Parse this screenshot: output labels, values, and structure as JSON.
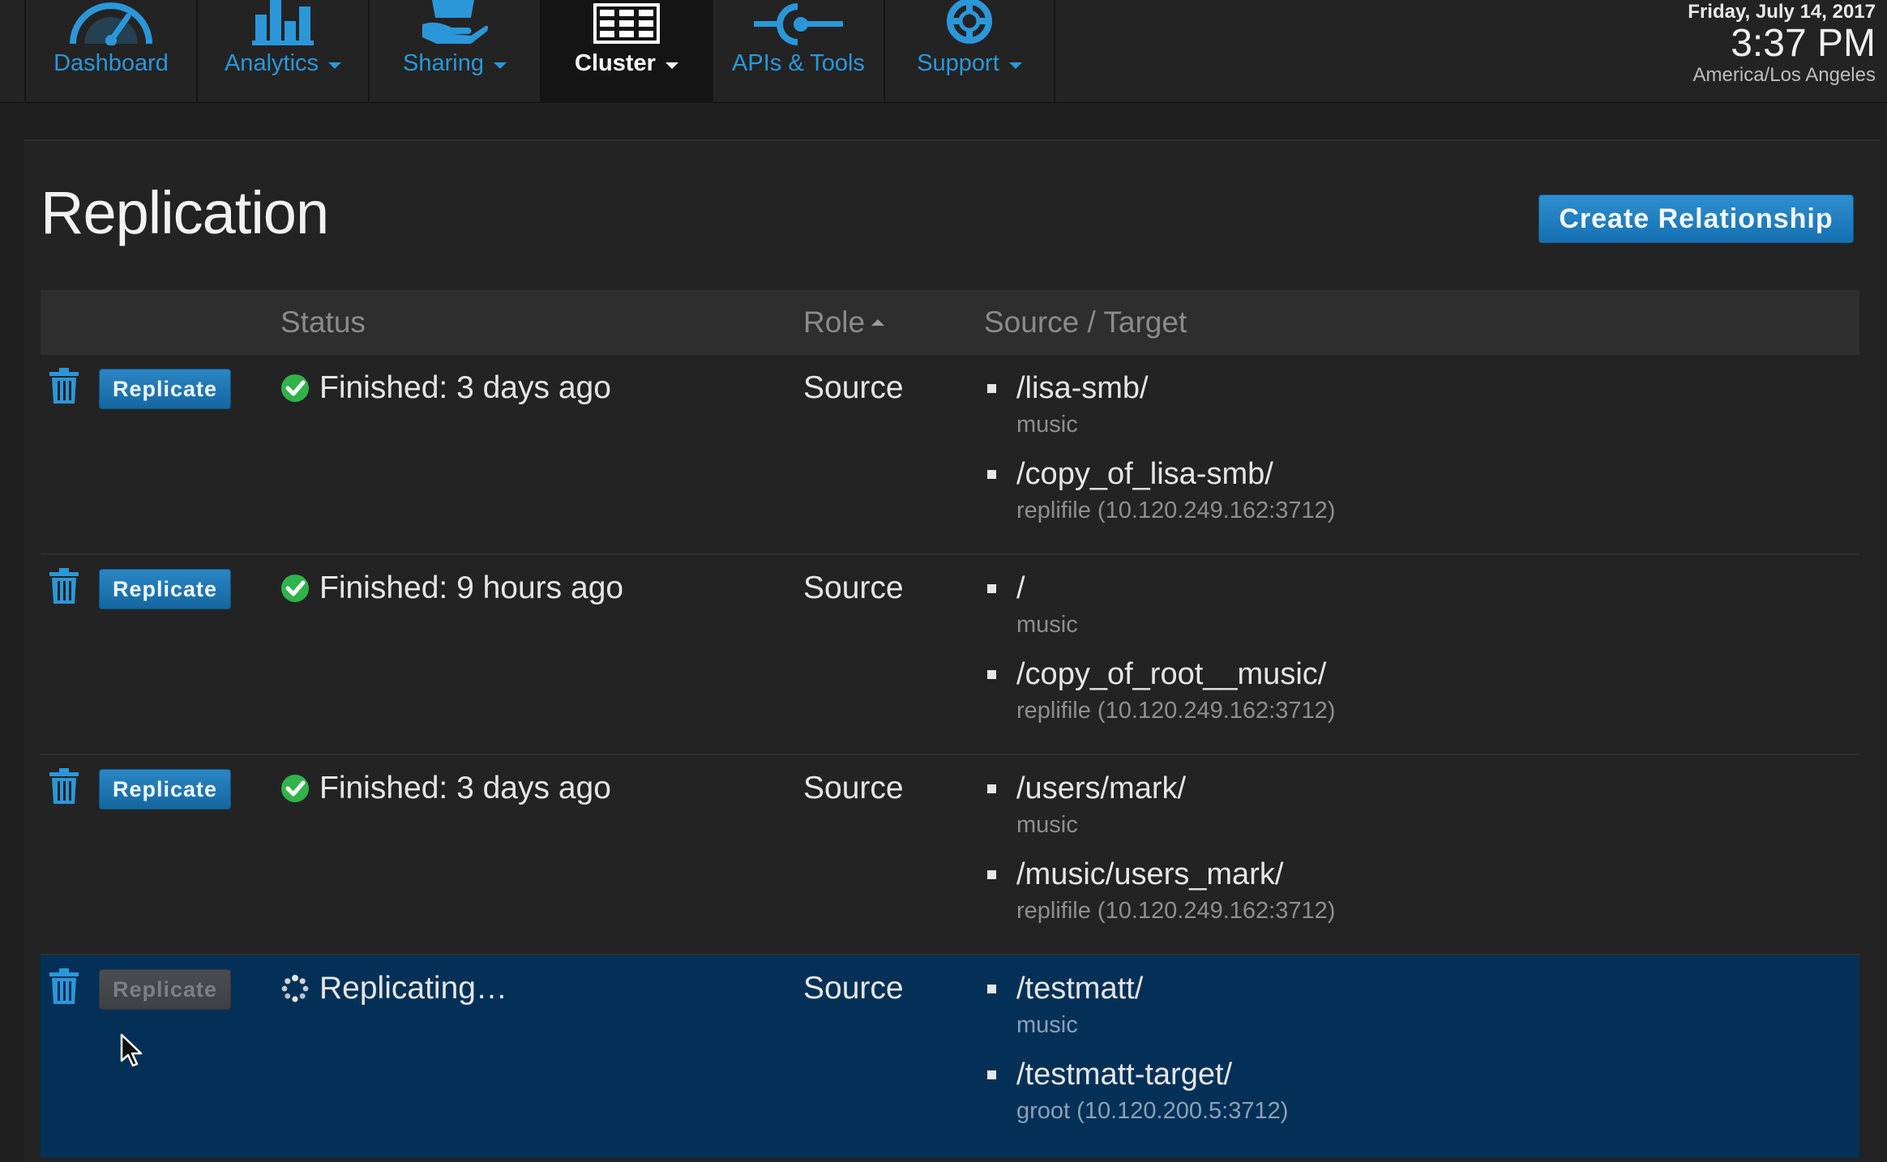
{
  "nav": {
    "items": [
      {
        "label": "Dashboard",
        "icon": "gauge-icon",
        "caret": false,
        "active": false
      },
      {
        "label": "Analytics",
        "icon": "bar-chart-icon",
        "caret": true,
        "active": false
      },
      {
        "label": "Sharing",
        "icon": "sharing-hand-icon",
        "caret": true,
        "active": false
      },
      {
        "label": "Cluster",
        "icon": "cluster-grid-icon",
        "caret": true,
        "active": true
      },
      {
        "label": "APIs & Tools",
        "icon": "api-connector-icon",
        "caret": false,
        "active": false
      },
      {
        "label": "Support",
        "icon": "lifebuoy-icon",
        "caret": true,
        "active": false
      }
    ]
  },
  "clock": {
    "date": "Friday, July 14, 2017",
    "time": "3:37 PM",
    "timezone": "America/Los Angeles"
  },
  "page": {
    "title": "Replication",
    "create_button": "Create Relationship"
  },
  "table": {
    "headers": {
      "status": "Status",
      "role": "Role",
      "source_target": "Source / Target"
    },
    "sort": {
      "column": "Role",
      "direction": "ascending"
    },
    "rows": [
      {
        "action": "Replicate",
        "action_enabled": true,
        "status": "Finished: 3 days ago",
        "status_icon": "check-circle-icon",
        "role": "Source",
        "source_path": "/lisa-smb/",
        "source_host": "music",
        "target_path": "/copy_of_lisa-smb/",
        "target_host": "replifile (10.120.249.162:3712)"
      },
      {
        "action": "Replicate",
        "action_enabled": true,
        "status": "Finished: 9 hours ago",
        "status_icon": "check-circle-icon",
        "role": "Source",
        "source_path": "/",
        "source_host": "music",
        "target_path": "/copy_of_root__music/",
        "target_host": "replifile (10.120.249.162:3712)"
      },
      {
        "action": "Replicate",
        "action_enabled": true,
        "status": "Finished: 3 days ago",
        "status_icon": "check-circle-icon",
        "role": "Source",
        "source_path": "/users/mark/",
        "source_host": "music",
        "target_path": "/music/users_mark/",
        "target_host": "replifile (10.120.249.162:3712)"
      },
      {
        "action": "Replicate",
        "action_enabled": false,
        "status": "Replicating…",
        "status_icon": "spinner-icon",
        "role": "Source",
        "source_path": "/testmatt/",
        "source_host": "music",
        "target_path": "/testmatt-target/",
        "target_host": "groot (10.120.200.5:3712)"
      }
    ]
  },
  "colors": {
    "accent": "#2b97d9",
    "background": "#1f1f1f",
    "selected_row": "#043057",
    "success": "#2fb34a"
  }
}
